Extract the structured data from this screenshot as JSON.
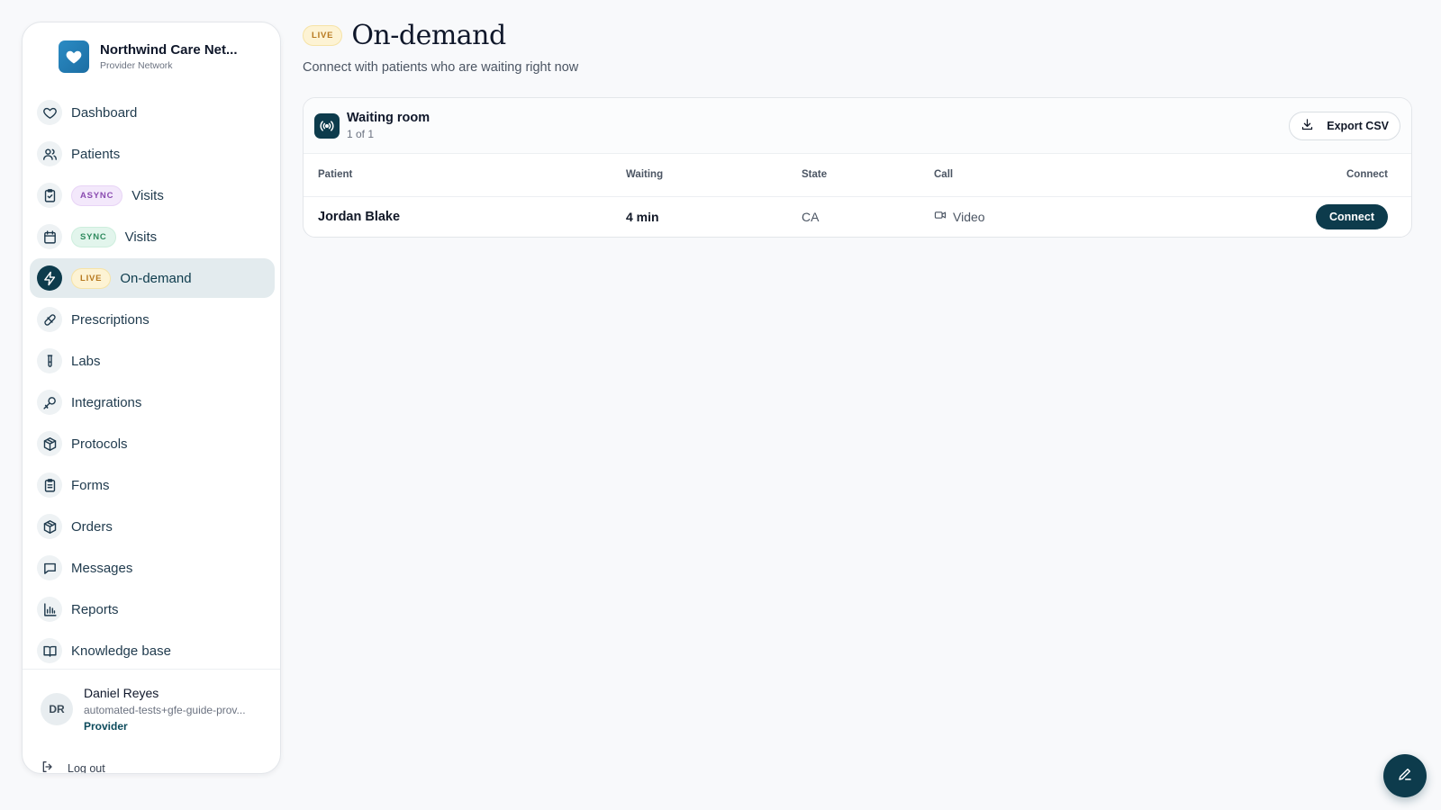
{
  "brand": {
    "name": "Northwind Care Net...",
    "subtitle": "Provider Network"
  },
  "nav": {
    "items": [
      {
        "label": "Dashboard",
        "icon": "heart-icon"
      },
      {
        "label": "Patients",
        "icon": "users-icon"
      },
      {
        "label": "Visits",
        "icon": "clipboard-check-icon",
        "badge": "ASYNC"
      },
      {
        "label": "Visits",
        "icon": "calendar-icon",
        "badge": "SYNC"
      },
      {
        "label": "On-demand",
        "icon": "lightning-icon",
        "badge": "LIVE",
        "active": true
      },
      {
        "label": "Prescriptions",
        "icon": "pill-icon"
      },
      {
        "label": "Labs",
        "icon": "test-tube-icon"
      },
      {
        "label": "Integrations",
        "icon": "key-icon"
      },
      {
        "label": "Protocols",
        "icon": "package-icon"
      },
      {
        "label": "Forms",
        "icon": "clipboard-list-icon"
      },
      {
        "label": "Orders",
        "icon": "package-icon"
      },
      {
        "label": "Messages",
        "icon": "message-icon"
      },
      {
        "label": "Reports",
        "icon": "bar-chart-icon"
      },
      {
        "label": "Knowledge base",
        "icon": "book-icon"
      }
    ]
  },
  "user": {
    "initials": "DR",
    "name": "Daniel Reyes",
    "email": "automated-tests+gfe-guide-prov...",
    "role": "Provider"
  },
  "logout_label": "Log out",
  "page": {
    "badge": "LIVE",
    "title": "On-demand",
    "subtitle": "Connect with patients who are waiting right now"
  },
  "waiting_room": {
    "title": "Waiting room",
    "count": "1 of 1",
    "export_label": "Export CSV",
    "columns": [
      "Patient",
      "Waiting",
      "State",
      "Call",
      "Connect"
    ],
    "rows": [
      {
        "patient": "Jordan Blake",
        "waiting": "4 min",
        "state": "CA",
        "call": "Video",
        "action": "Connect"
      }
    ]
  },
  "colors": {
    "primary": "#0d3b4c",
    "brand": "#2b8bc4",
    "live": "#b7791f"
  }
}
